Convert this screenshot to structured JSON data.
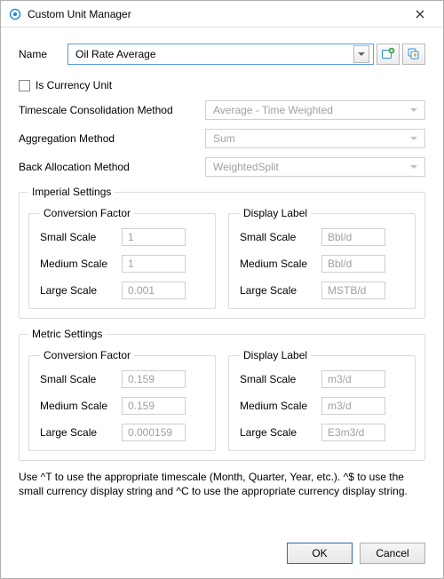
{
  "window": {
    "title": "Custom Unit Manager"
  },
  "name": {
    "label": "Name",
    "value": "Oil Rate Average"
  },
  "isCurrency": {
    "label": "Is Currency Unit",
    "checked": false
  },
  "timescale": {
    "label": "Timescale Consolidation Method",
    "value": "Average - Time Weighted"
  },
  "aggregation": {
    "label": "Aggregation Method",
    "value": "Sum"
  },
  "backAllocation": {
    "label": "Back Allocation Method",
    "value": "WeightedSplit"
  },
  "imperial": {
    "legend": "Imperial Settings",
    "conversion": {
      "legend": "Conversion Factor",
      "small": {
        "label": "Small Scale",
        "value": "1"
      },
      "medium": {
        "label": "Medium Scale",
        "value": "1"
      },
      "large": {
        "label": "Large Scale",
        "value": "0.001"
      }
    },
    "display": {
      "legend": "Display Label",
      "small": {
        "label": "Small Scale",
        "value": "Bbl/d"
      },
      "medium": {
        "label": "Medium Scale",
        "value": "Bbl/d"
      },
      "large": {
        "label": "Large Scale",
        "value": "MSTB/d"
      }
    }
  },
  "metric": {
    "legend": "Metric Settings",
    "conversion": {
      "legend": "Conversion Factor",
      "small": {
        "label": "Small Scale",
        "value": "0.159"
      },
      "medium": {
        "label": "Medium Scale",
        "value": "0.159"
      },
      "large": {
        "label": "Large Scale",
        "value": "0.000159"
      }
    },
    "display": {
      "legend": "Display Label",
      "small": {
        "label": "Small Scale",
        "value": "m3/d"
      },
      "medium": {
        "label": "Medium Scale",
        "value": "m3/d"
      },
      "large": {
        "label": "Large Scale",
        "value": "E3m3/d"
      }
    }
  },
  "hint": "Use ^T to use the appropriate timescale (Month, Quarter, Year, etc.). ^$ to use the small currency display string and ^C to use the appropriate currency display string.",
  "buttons": {
    "ok": "OK",
    "cancel": "Cancel"
  },
  "icons": {
    "add": "add-unit-icon",
    "duplicate": "duplicate-unit-icon"
  }
}
